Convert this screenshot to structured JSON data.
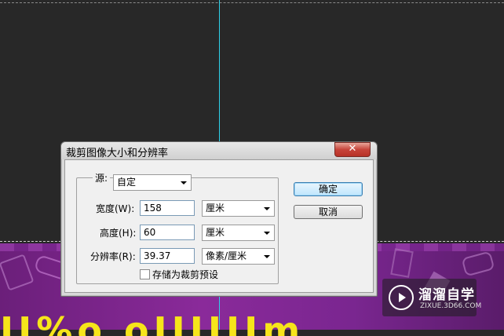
{
  "dialog": {
    "title": "裁剪图像大小和分辨率",
    "close_symbol": "✕",
    "fields": {
      "source_label": "源:",
      "source_value": "自定",
      "width_label": "宽度(W):",
      "width_value": "158",
      "width_unit": "厘米",
      "height_label": "高度(H):",
      "height_value": "60",
      "height_unit": "厘米",
      "resolution_label": "分辨率(R):",
      "resolution_value": "39.37",
      "resolution_unit": "像素/厘米",
      "save_preset_label": "存储为裁剪预设",
      "save_preset_checked": false
    },
    "buttons": {
      "ok": "确定",
      "cancel": "取消"
    }
  },
  "watermark": {
    "title": "溜溜自学",
    "subtitle": "ZIXUE.3D66.COM"
  },
  "banner": {
    "text": "II%o oIIIIIIm"
  },
  "colors": {
    "canvas": "#282828",
    "guide": "#2fd0e8",
    "banner": "#7a2690",
    "banner_text": "#f6e51a"
  }
}
